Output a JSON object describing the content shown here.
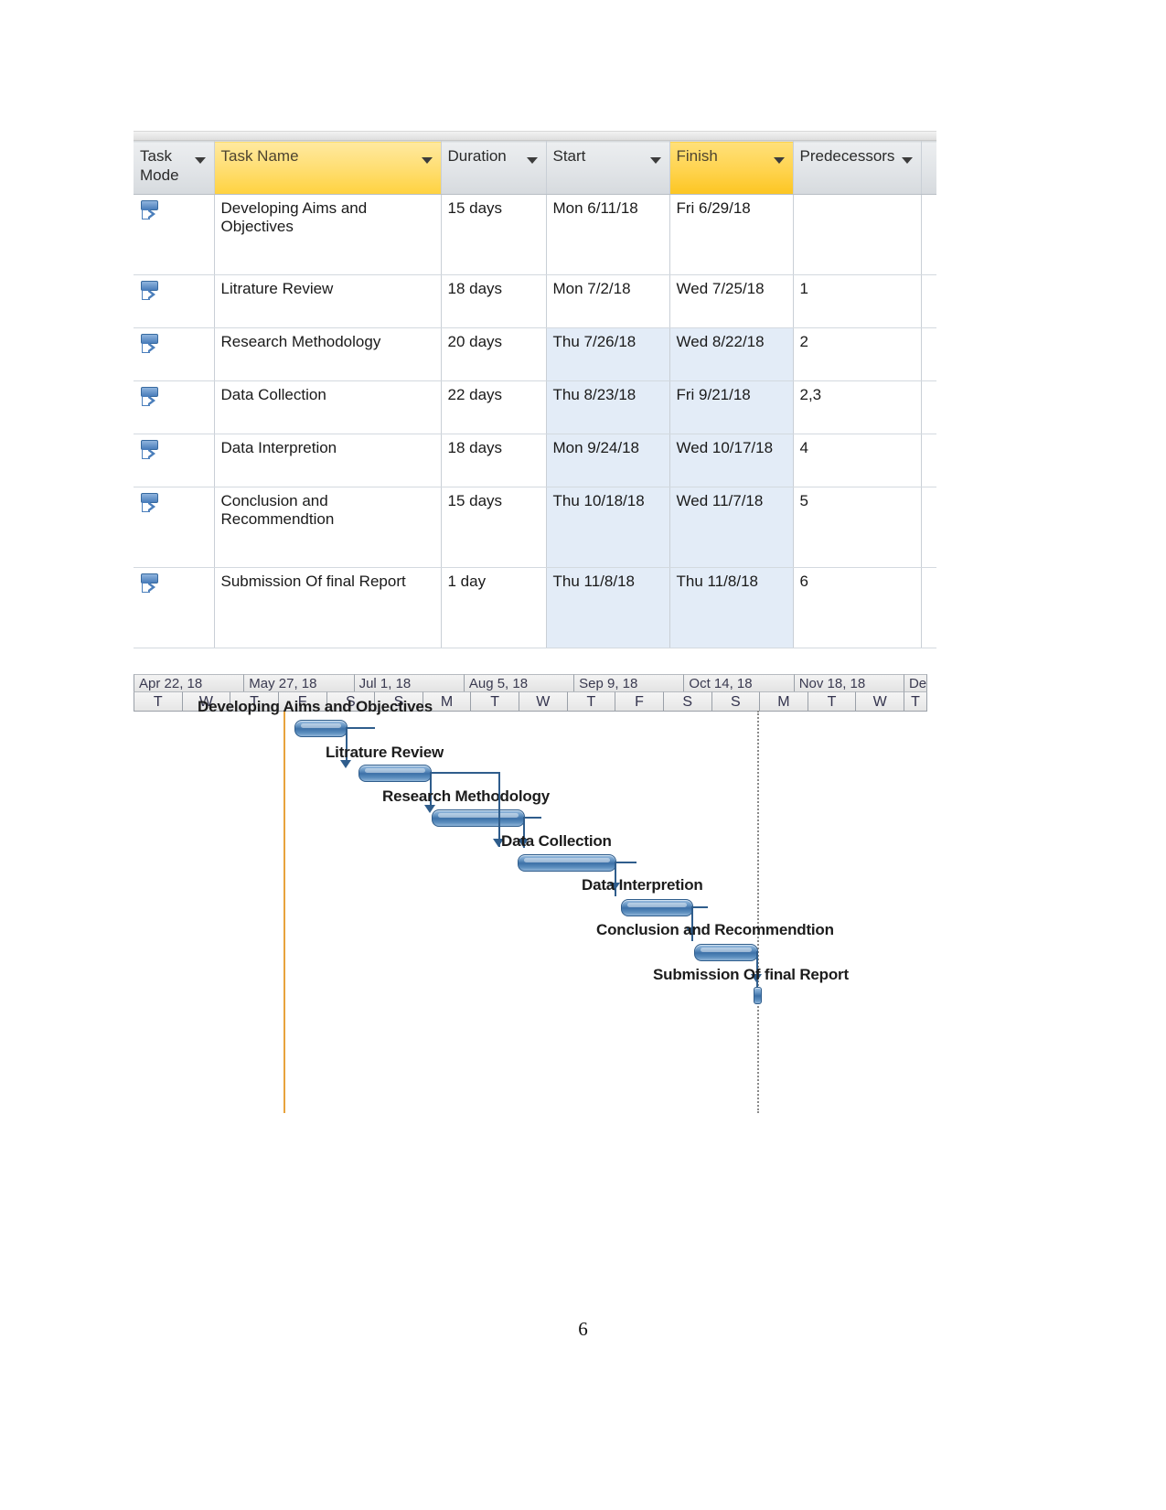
{
  "table": {
    "columns": [
      {
        "label": "Task Mode",
        "style": "plain",
        "has_filter": true
      },
      {
        "label": "Task Name",
        "style": "highlight",
        "has_filter": true
      },
      {
        "label": "Duration",
        "style": "plain",
        "has_filter": true
      },
      {
        "label": "Start",
        "style": "plain",
        "has_filter": true
      },
      {
        "label": "Finish",
        "style": "highlight-strong",
        "has_filter": true
      },
      {
        "label": "Predecessors",
        "style": "plain",
        "has_filter": true
      }
    ],
    "rows": [
      {
        "mode_icon": "manually-scheduled-icon",
        "name": "Developing Aims and Objectives",
        "duration": "15 days",
        "start": "Mon 6/11/18",
        "finish": "Fri 6/29/18",
        "predecessors": ""
      },
      {
        "mode_icon": "manually-scheduled-icon",
        "name": "Litrature Review",
        "duration": "18 days",
        "start": "Mon 7/2/18",
        "finish": "Wed 7/25/18",
        "predecessors": "1"
      },
      {
        "mode_icon": "manually-scheduled-icon",
        "name": "Research Methodology",
        "duration": "20 days",
        "start": "Thu 7/26/18",
        "finish": "Wed 8/22/18",
        "predecessors": "2"
      },
      {
        "mode_icon": "manually-scheduled-icon",
        "name": "Data Collection",
        "duration": "22 days",
        "start": "Thu 8/23/18",
        "finish": "Fri 9/21/18",
        "predecessors": "2,3"
      },
      {
        "mode_icon": "manually-scheduled-icon",
        "name": "Data Interpretion",
        "duration": "18 days",
        "start": "Mon 9/24/18",
        "finish": "Wed 10/17/18",
        "predecessors": "4"
      },
      {
        "mode_icon": "manually-scheduled-icon",
        "name": "Conclusion and Recommendtion",
        "duration": "15 days",
        "start": "Thu 10/18/18",
        "finish": "Wed 11/7/18",
        "predecessors": "5"
      },
      {
        "mode_icon": "manually-scheduled-icon",
        "name": "Submission Of final Report",
        "duration": "1 day",
        "start": "Thu 11/8/18",
        "finish": "Thu 11/8/18",
        "predecessors": "6"
      }
    ]
  },
  "gantt": {
    "timeline_months": [
      "Apr 22, 18",
      "May 27, 18",
      "Jul 1, 18",
      "Aug 5, 18",
      "Sep 9, 18",
      "Oct 14, 18",
      "Nov 18, 18",
      "Dec"
    ],
    "timeline_days": [
      "T",
      "W",
      "T",
      "F",
      "S",
      "S",
      "M",
      "T",
      "W",
      "T",
      "F",
      "S",
      "S",
      "M",
      "T",
      "W",
      "T"
    ],
    "bars": [
      {
        "label": "Developing Aims and Objectives",
        "start": "Mon 6/11/18",
        "finish": "Fri 6/29/18",
        "duration": "15 days"
      },
      {
        "label": "Litrature Review",
        "start": "Mon 7/2/18",
        "finish": "Wed 7/25/18",
        "duration": "18 days"
      },
      {
        "label": "Research Methodology",
        "start": "Thu 7/26/18",
        "finish": "Wed 8/22/18",
        "duration": "20 days"
      },
      {
        "label": "Data Collection",
        "start": "Thu 8/23/18",
        "finish": "Fri 9/21/18",
        "duration": "22 days"
      },
      {
        "label": "Data Interpretion",
        "start": "Mon 9/24/18",
        "finish": "Wed 10/17/18",
        "duration": "18 days"
      },
      {
        "label": "Conclusion and Recommendtion",
        "start": "Thu 10/18/18",
        "finish": "Wed 11/7/18",
        "duration": "15 days"
      },
      {
        "label": "Submission Of final Report",
        "start": "Thu 11/8/18",
        "finish": "Thu 11/8/18",
        "duration": "1 day"
      }
    ],
    "colors": {
      "bar_fill": "#4a7ebb",
      "bar_border": "#2f5d8c",
      "today_line": "#e8a33d",
      "status_line": "#8a8a8a"
    }
  },
  "page": {
    "number": "6"
  }
}
